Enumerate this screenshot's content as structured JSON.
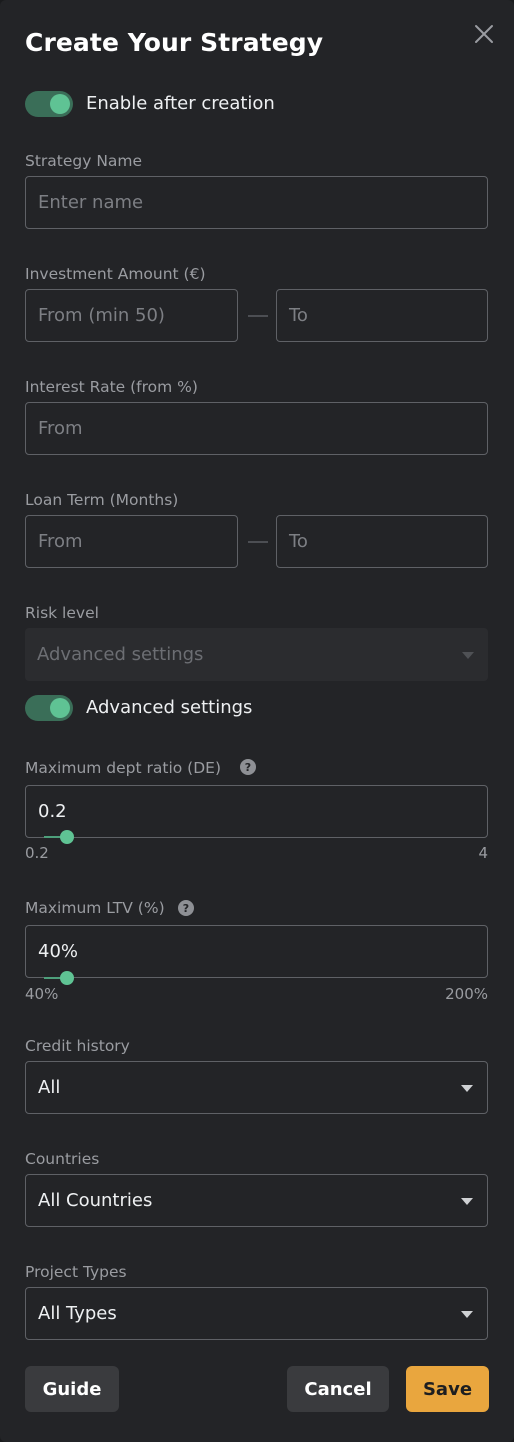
{
  "modal": {
    "title": "Create Your Strategy",
    "close_icon": "close-icon"
  },
  "enable_toggle": {
    "label": "Enable after creation",
    "on": true
  },
  "strategy_name": {
    "label": "Strategy Name",
    "placeholder": "Enter name"
  },
  "investment_amount": {
    "label": "Investment Amount (€)",
    "from_placeholder": "From (min 50)",
    "to_placeholder": "To"
  },
  "interest_rate": {
    "label": "Interest Rate (from %)",
    "placeholder": "From"
  },
  "loan_term": {
    "label": "Loan Term (Months)",
    "from_placeholder": "From",
    "to_placeholder": "To"
  },
  "risk_level": {
    "label": "Risk level",
    "value": "Advanced settings",
    "disabled": true
  },
  "advanced_toggle": {
    "label": "Advanced settings",
    "on": true
  },
  "max_debt_ratio": {
    "label": "Maximum dept ratio (DE)",
    "help_icon": "?",
    "value": "0.2",
    "min_label": "0.2",
    "max_label": "4"
  },
  "max_ltv": {
    "label": "Maximum LTV (%)",
    "help_icon": "?",
    "value": "40%",
    "min_label": "40%",
    "max_label": "200%"
  },
  "credit_history": {
    "label": "Credit history",
    "value": "All"
  },
  "countries": {
    "label": "Countries",
    "value": "All Countries"
  },
  "project_types": {
    "label": "Project Types",
    "value": "All Types"
  },
  "buttons": {
    "guide": "Guide",
    "cancel": "Cancel",
    "save": "Save"
  },
  "colors": {
    "accent_green": "#5fc394",
    "save_button": "#e9a63e",
    "background": "#232427"
  }
}
